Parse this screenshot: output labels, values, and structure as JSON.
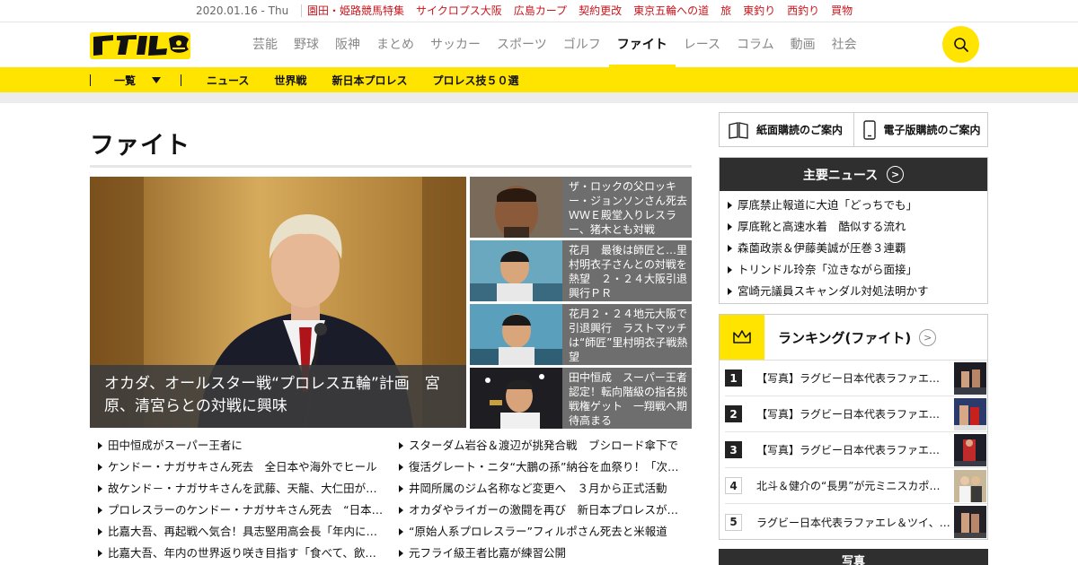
{
  "topbar": {
    "date": "2020.01.16 - Thu",
    "links": [
      "園田・姫路競馬特集",
      "サイクロプス大阪",
      "広島カープ",
      "契約更改",
      "東京五輪への道",
      "旅",
      "東釣り",
      "西釣り",
      "買物"
    ]
  },
  "header": {
    "logo_text": "デイリー",
    "nav": [
      "芸能",
      "野球",
      "阪神",
      "まとめ",
      "サッカー",
      "スポーツ",
      "ゴルフ",
      "ファイト",
      "レース",
      "コラム",
      "動画",
      "社会"
    ],
    "active_nav": "ファイト"
  },
  "subnav": {
    "list_label": "一覧",
    "items": [
      "ニュース",
      "世界戦",
      "新日本プロレス",
      "プロレス技５０選"
    ]
  },
  "page": {
    "title": "ファイト"
  },
  "hero": {
    "caption": "オカダ、オールスター戦“プロレス五輪”計画　宮原、清宮らとの対戦に興味"
  },
  "sub_articles": [
    {
      "title": "ザ・ロックの父ロッキー・ジョンソンさん死去　ＷＷＥ殿堂入りレスラー、猪木とも対戦"
    },
    {
      "title": "花月　最後は師匠と…里村明衣子さんとの対戦を熱望　２・２４大阪引退興行ＰＲ"
    },
    {
      "title": "花月２・２４地元大阪で引退興行　ラストマッチは“師匠”里村明衣子戦熱望"
    },
    {
      "title": "田中恒成　スーパー王者認定！転向階級の指名挑戦権ゲット　一翔戦へ期待高まる"
    }
  ],
  "news_list_left": [
    "田中恒成がスーパー王者に",
    "ケンドー・ナガサキさん死去　全日本や海外でヒール",
    "故ケンド－・ナガサキさんを武藤、天龍、大仁田が追悼",
    "プロレスラーのケンドー・ナガサキさん死去　“日本人初のUFC”",
    "比嘉大吾、再起戦へ気合！具志堅用高会長「年内に世界戦」",
    "比嘉大吾、年内の世界返り咲き目指す「食べて、飲んで」"
  ],
  "news_list_right": [
    "スターダム岩谷＆渡辺が挑発合戦　ブシロード傘下で",
    "復活グレート・ニタ“大鵬の孫”納谷を血祭り！「次は」",
    "井岡所属のジム名称など変更へ　３月から正式活動",
    "オカダやライガーの激闘を再び　新日本プロレスが特番",
    "“原始人系プロレスラー”フィルポさん死去と米報道",
    "元フライ級王者比嘉が練習公開"
  ],
  "sidebar": {
    "print_sub": "紙面購読のご案内",
    "digital_sub": "電子版購読のご案内",
    "main_news_title": "主要ニュース",
    "main_news": [
      "厚底禁止報道に大迫「どっちでも」",
      "厚底靴と高速水着　酷似する流れ",
      "森薗政崇＆伊藤美誠が圧巻３連覇",
      "トリンドル玲奈「泣きながら面接」",
      "宮崎元議員スキャンダル対処法明かす"
    ],
    "ranking_title": "ランキング(ファイト)",
    "ranking": [
      {
        "rank": "1",
        "title": "【写真】ラグビー日本代表ラファエレ＆ツイ、プロレス"
      },
      {
        "rank": "2",
        "title": "【写真】ラグビー日本代表ラファエレ＆ツイ、リング"
      },
      {
        "rank": "3",
        "title": "【写真】ラグビー日本代表ラファエレ＆ツイ、観戦"
      },
      {
        "rank": "4",
        "title": "北斗＆健介の“長男”が元ミニスカポリスと結婚"
      },
      {
        "rank": "5",
        "title": "ラグビー日本代表ラファエレ＆ツイ、プロレス観戦"
      }
    ],
    "photos_title": "写真"
  },
  "colors": {
    "accent": "#ffe400",
    "topbar_link": "#c8161d",
    "dark": "#2f2f2f"
  }
}
